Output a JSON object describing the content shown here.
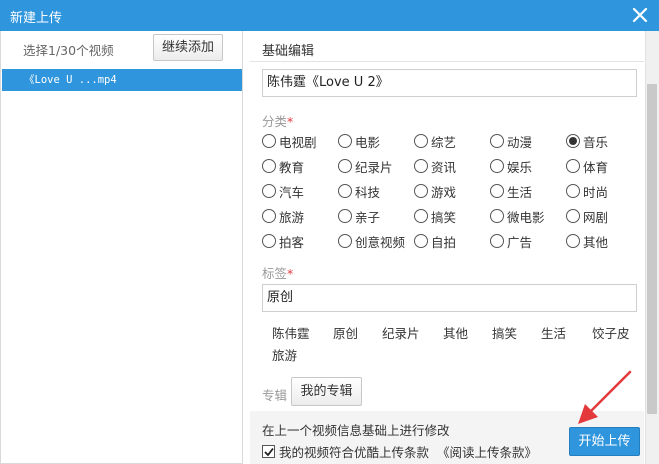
{
  "window": {
    "title": "新建上传",
    "close_icon": "close-icon"
  },
  "left": {
    "count_text": "选择1/30个视频",
    "add_button": "继续添加",
    "files": [
      {
        "name": "《Love U ...mp4"
      }
    ]
  },
  "editor": {
    "section_title": "基础编辑",
    "title_value": "陈伟霆《Love U 2》",
    "category_label": "分类",
    "required_mark": "*",
    "categories": [
      "电视剧",
      "电影",
      "综艺",
      "动漫",
      "音乐",
      "教育",
      "纪录片",
      "资讯",
      "娱乐",
      "体育",
      "汽车",
      "科技",
      "游戏",
      "生活",
      "时尚",
      "旅游",
      "亲子",
      "搞笑",
      "微电影",
      "网剧",
      "拍客",
      "创意视频",
      "自拍",
      "广告",
      "其他"
    ],
    "selected_category": "音乐",
    "tags_label": "标签",
    "tags_value": "原创",
    "tag_suggestions": [
      "陈伟霆",
      "原创",
      "纪录片",
      "其他",
      "搞笑",
      "生活",
      "饺子皮",
      "旅游"
    ],
    "album_label": "专辑",
    "album_button": "我的专辑",
    "inherit_text": "在上一个视频信息基础上进行修改",
    "agree_text": "我的视频符合优酷上传条款",
    "terms_link": "《阅读上传条款》",
    "agree_checked": true,
    "start_button": "开始上传"
  },
  "colors": {
    "accent": "#2f95dd",
    "required": "#e4393c",
    "arrow": "#e4393c"
  }
}
